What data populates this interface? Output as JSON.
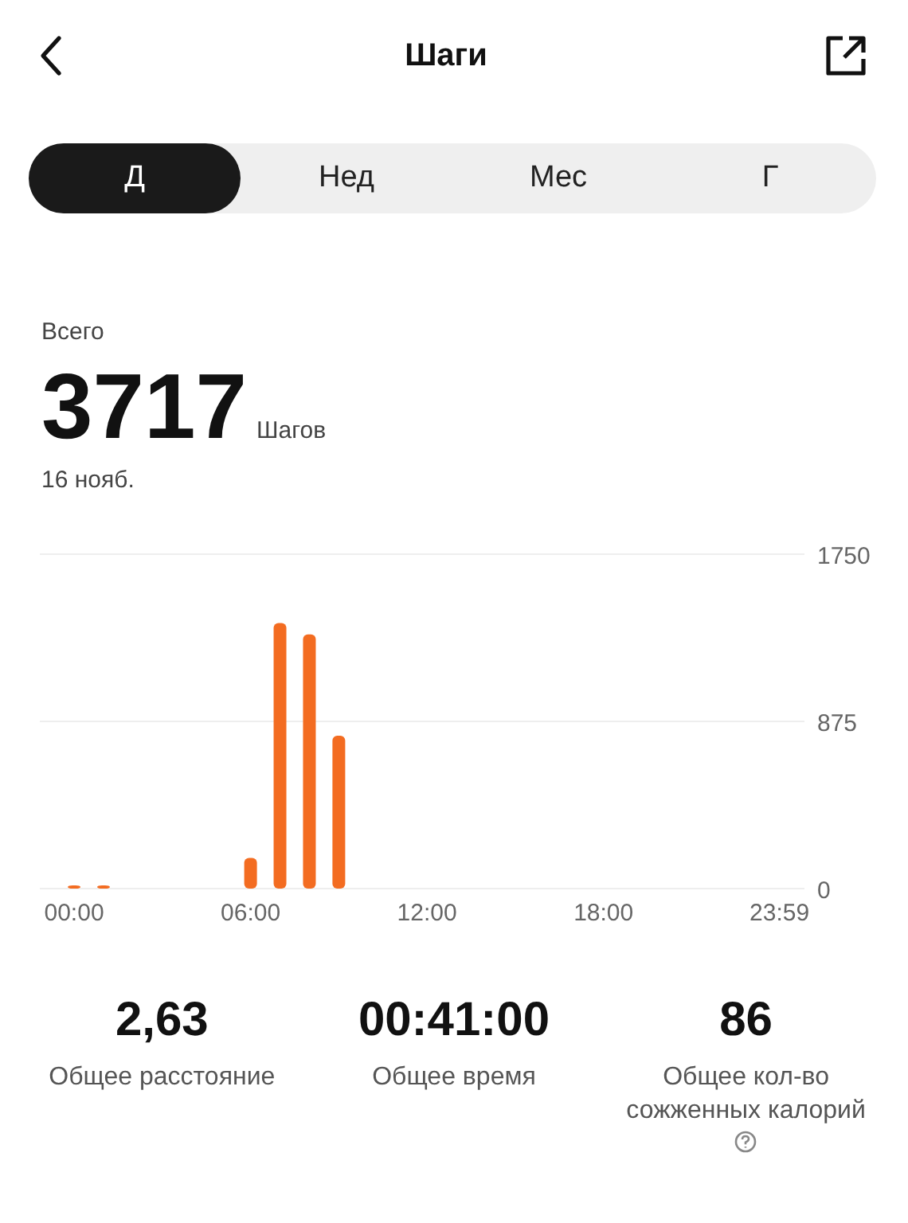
{
  "header": {
    "title": "Шаги"
  },
  "tabs": [
    {
      "label": "Д",
      "selected": true
    },
    {
      "label": "Нед",
      "selected": false
    },
    {
      "label": "Мес",
      "selected": false
    },
    {
      "label": "Г",
      "selected": false
    }
  ],
  "summary": {
    "caption": "Всего",
    "value": "3717",
    "unit": "Шагов",
    "date": "16 нояб."
  },
  "chart_data": {
    "type": "bar",
    "x": [
      0,
      60,
      360,
      420,
      480,
      540
    ],
    "series": [
      {
        "color": "#f36c21",
        "values": [
          10,
          10,
          160,
          1390,
          1330,
          800
        ]
      }
    ],
    "xlim": [
      -70,
      1490
    ],
    "ylim": [
      0,
      1750
    ],
    "xticks": [
      {
        "value": 0,
        "label": "00:00"
      },
      {
        "value": 360,
        "label": "06:00"
      },
      {
        "value": 720,
        "label": "12:00"
      },
      {
        "value": 1080,
        "label": "18:00"
      },
      {
        "value": 1439,
        "label": "23:59"
      }
    ],
    "yticks": [
      0,
      875,
      1750
    ]
  },
  "stats": [
    {
      "value": "2,63",
      "label": "Общее расстояние",
      "info": false
    },
    {
      "value": "00:41:00",
      "label": "Общее время",
      "info": false
    },
    {
      "value": "86",
      "label": "Общее кол-во сожженных калорий",
      "info": true
    }
  ]
}
